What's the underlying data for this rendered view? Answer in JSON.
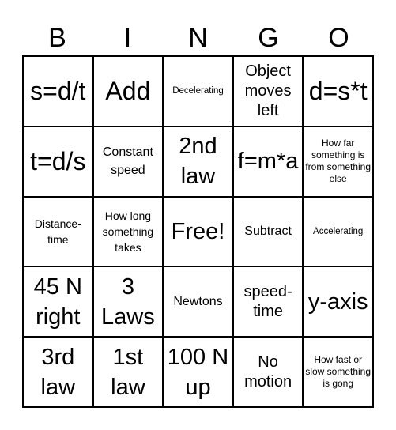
{
  "header": [
    "B",
    "I",
    "N",
    "G",
    "O"
  ],
  "cells": [
    [
      "s=d/t",
      "Add",
      "Decelerating",
      "Object moves left",
      "d=s*t"
    ],
    [
      "t=d/s",
      "Constant speed",
      "2nd law",
      "f=m*a",
      "How far something is from something else"
    ],
    [
      "Distance-time",
      "How long something takes",
      "Free!",
      "Subtract",
      "Accelerating"
    ],
    [
      "45 N right",
      "3 Laws",
      "Newtons",
      "speed-time",
      "y-axis"
    ],
    [
      "3rd law",
      "1st law",
      "100 N up",
      "No motion",
      "How fast or slow something is gong"
    ]
  ]
}
